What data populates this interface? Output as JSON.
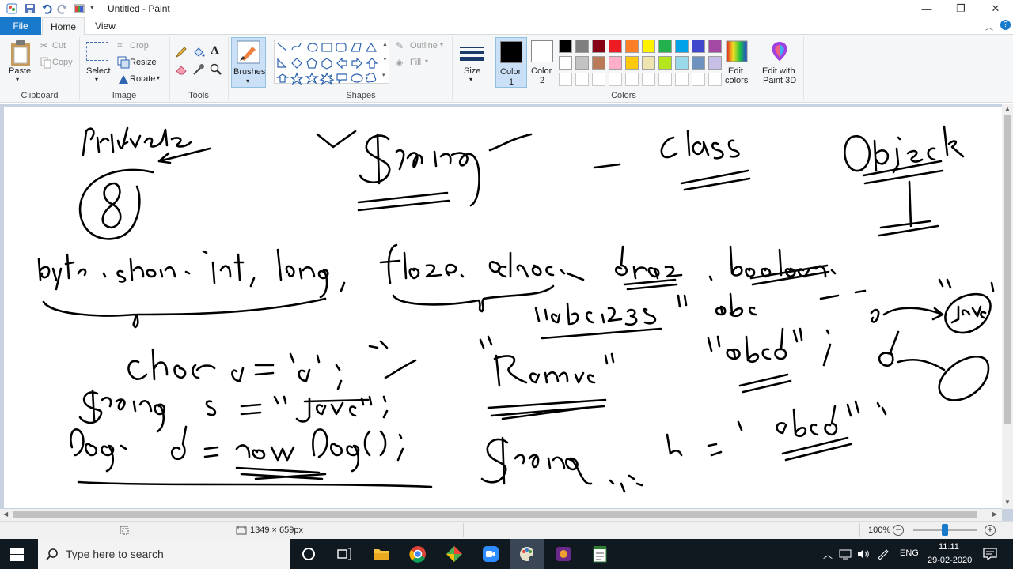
{
  "window": {
    "title": "Untitled - Paint",
    "minimize": "—",
    "maximize": "❐",
    "close": "✕"
  },
  "tabs": {
    "file": "File",
    "home": "Home",
    "view": "View"
  },
  "ribbon": {
    "clipboard": {
      "paste": "Paste",
      "cut": "Cut",
      "copy": "Copy",
      "label": "Clipboard"
    },
    "image": {
      "select": "Select",
      "crop": "Crop",
      "resize": "Resize",
      "rotate": "Rotate",
      "label": "Image"
    },
    "tools": {
      "label": "Tools"
    },
    "brushes": {
      "label": "Brushes"
    },
    "shapes": {
      "outline": "Outline",
      "fill": "Fill",
      "label": "Shapes"
    },
    "size": {
      "label": "Size"
    },
    "color1": {
      "label": "Color",
      "num": "1"
    },
    "color2": {
      "label": "Color",
      "num": "2"
    },
    "colors": {
      "label": "Colors",
      "edit_colors_1": "Edit",
      "edit_colors_2": "colors",
      "edit_paint3d_1": "Edit with",
      "edit_paint3d_2": "Paint 3D",
      "row1": [
        "#000000",
        "#7f7f7f",
        "#880015",
        "#ed1c24",
        "#ff7f27",
        "#fff200",
        "#22b14c",
        "#00a2e8",
        "#3f48cc",
        "#a349a4"
      ],
      "row2": [
        "#ffffff",
        "#c3c3c3",
        "#b97a57",
        "#ffaec9",
        "#ffc90e",
        "#efe4b0",
        "#b5e61d",
        "#99d9ea",
        "#7092be",
        "#c8bfe7"
      ],
      "primary": "#000000",
      "secondary": "#ffffff"
    }
  },
  "canvas": {
    "text_labels": {
      "primitive": "Primitive",
      "eight": "8",
      "string": "String",
      "class": "class",
      "object": "Object",
      "types": "byte, short, int, long, float, double, char, boolean",
      "abc123": "\"abc123\"",
      "abc": "abc",
      "java": "\"java\"",
      "ramu": "\"Ramu\"",
      "abcd": "\"abcd\";",
      "char_line": "char a = 'a';",
      "string_line": "String s = \"java\";",
      "dog_line": "Dog d = new Dog();",
      "string_s": "String s = \"abcd\";"
    }
  },
  "status": {
    "size": "1349 × 659px",
    "zoom": "100%"
  },
  "taskbar": {
    "search_placeholder": "Type here to search",
    "lang": "ENG",
    "time": "11:11",
    "date": "29-02-2020"
  }
}
